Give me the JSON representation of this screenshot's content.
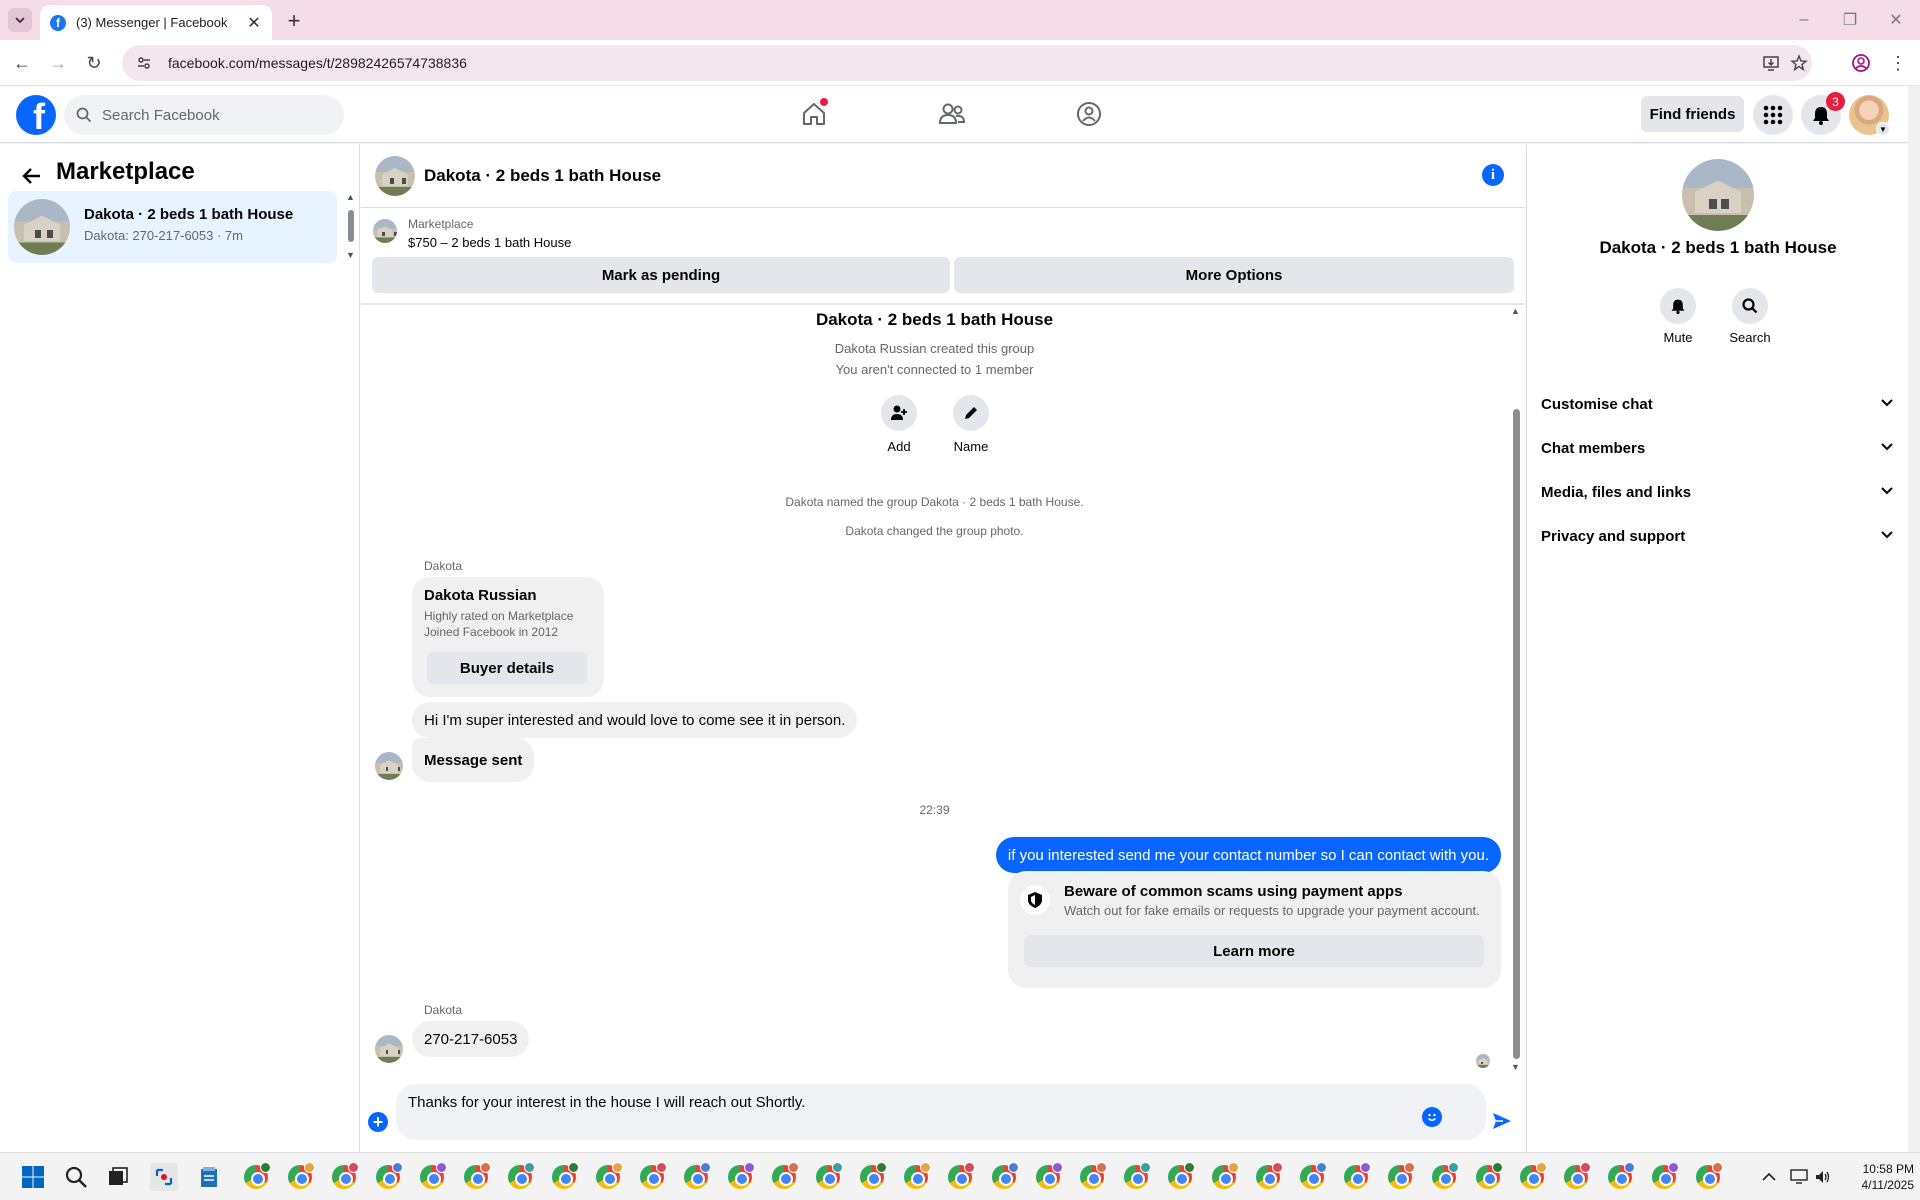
{
  "browser": {
    "tab_title": "(3) Messenger | Facebook",
    "url": "facebook.com/messages/t/28982426574738836"
  },
  "header": {
    "search_placeholder": "Search Facebook",
    "find_friends": "Find friends",
    "notification_count": "3"
  },
  "sidebar": {
    "title": "Marketplace",
    "items": [
      {
        "name": "Dakota · 2 beds 1 bath House",
        "subtitle": "Dakota: 270-217-6053 · 7m"
      }
    ]
  },
  "conversation": {
    "title": "Dakota · 2 beds 1 bath House",
    "marketplace_label": "Marketplace",
    "listing": "$750 – 2 beds 1 bath House",
    "mark_pending": "Mark as pending",
    "more_options": "More Options"
  },
  "messages": {
    "group_title": "Dakota · 2 beds 1 bath House",
    "created_by": "Dakota Russian created this group",
    "not_connected": "You aren't connected to 1 member",
    "actions": [
      {
        "label": "Add"
      },
      {
        "label": "Name"
      }
    ],
    "system_1": "Dakota named the group Dakota · 2 beds 1 bath House.",
    "system_2": "Dakota changed the group photo.",
    "sender_1": "Dakota",
    "buyer_card": {
      "name": "Dakota Russian",
      "line1": "Highly rated on Marketplace",
      "line2": "Joined Facebook in 2012",
      "button": "Buyer details"
    },
    "incoming_1": "Hi I'm super interested and would love to come see it in person.",
    "incoming_2": "Message sent",
    "timestamp": "22:39",
    "outgoing_1": "if you interested send me your contact number so I can contact with you.",
    "scam_notice": {
      "title": "Beware of common scams using payment apps",
      "body": "Watch out for fake emails or requests to upgrade your payment account.",
      "button": "Learn more"
    },
    "sender_2": "Dakota",
    "incoming_3": "270-217-6053"
  },
  "composer": {
    "text": "Thanks for your interest in the house I will reach out Shortly."
  },
  "right_panel": {
    "name": "Dakota · 2 beds 1 bath House",
    "mute": "Mute",
    "search": "Search",
    "sections": [
      {
        "label": "Customise chat"
      },
      {
        "label": "Chat members"
      },
      {
        "label": "Media, files and links"
      },
      {
        "label": "Privacy and support"
      }
    ]
  },
  "taskbar": {
    "time": "10:58 PM",
    "date": "4/11/2025"
  },
  "colors": {
    "accent": "#0866ff",
    "badge": "#e41e3f",
    "tabstrip": "#f4dde9"
  }
}
